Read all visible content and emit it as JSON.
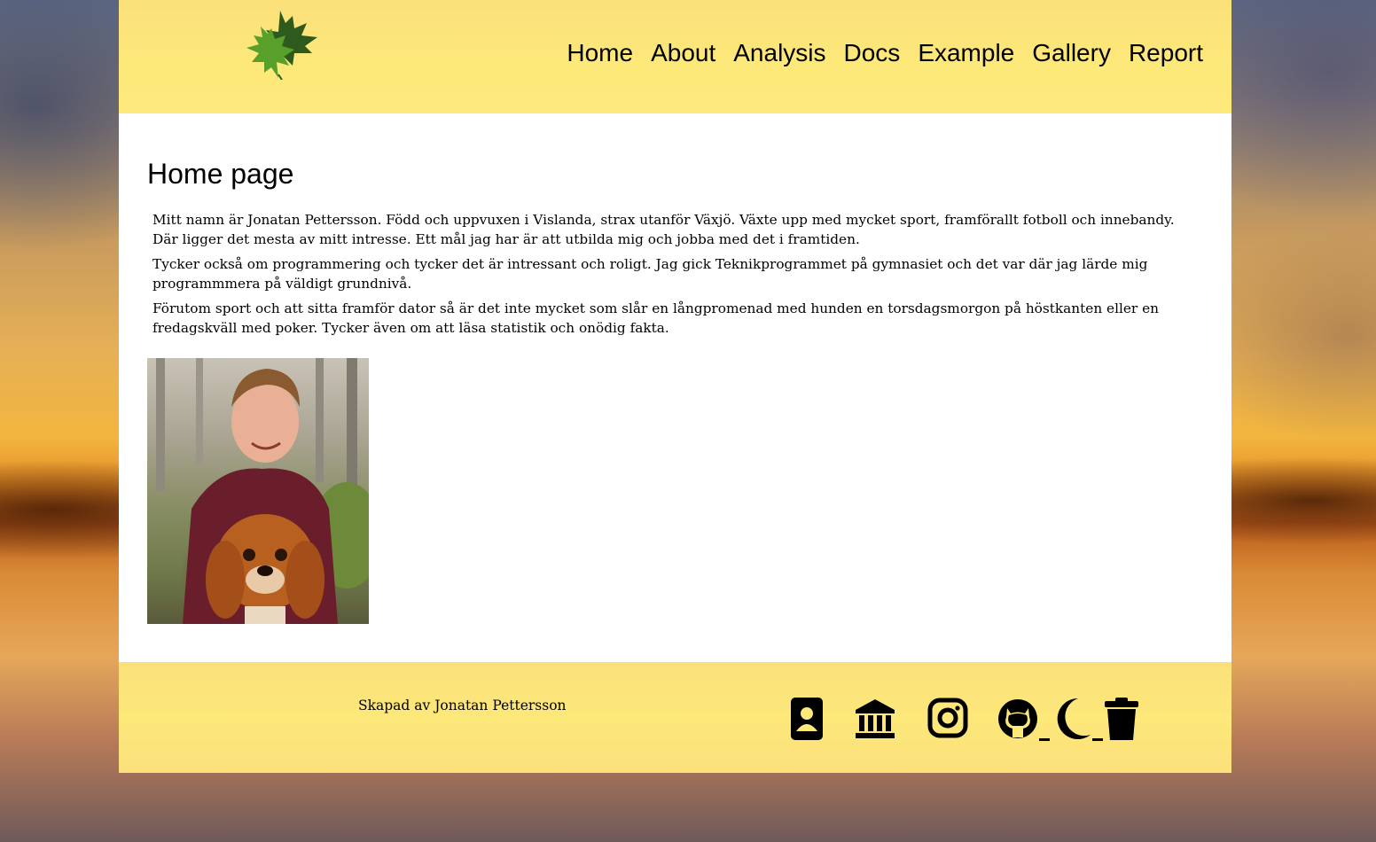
{
  "site": {
    "logo_icon": "maple-leaf-logo"
  },
  "nav": {
    "items": [
      {
        "label": "Home",
        "name": "nav-home"
      },
      {
        "label": "About",
        "name": "nav-about"
      },
      {
        "label": "Analysis",
        "name": "nav-analysis"
      },
      {
        "label": "Docs",
        "name": "nav-docs"
      },
      {
        "label": "Example",
        "name": "nav-example"
      },
      {
        "label": "Gallery",
        "name": "nav-gallery"
      },
      {
        "label": "Report",
        "name": "nav-report"
      }
    ]
  },
  "main": {
    "title": "Home page",
    "paragraphs": [
      "Mitt namn är Jonatan Pettersson. Född och uppvuxen i Vislanda, strax utanför Växjö. Växte upp med mycket sport, framförallt fotboll och innebandy. Där ligger det mesta av mitt intresse. Ett mål jag har är att utbilda mig och jobba med det i framtiden.",
      "Tycker också om programmering och tycker det är intressant och roligt. Jag gick Teknikprogrammet på gymnasiet och det var där jag lärde mig programmmera på väldigt grundnivå.",
      "Förutom sport och att sitta framför dator så är det inte mycket som slår en långpromenad med hunden en torsdagsmorgon på höstkanten eller en fredagskväll med poker. Tycker även om att läsa statistik och onödig fakta."
    ],
    "photo_icon": "profile-photo"
  },
  "footer": {
    "credit": "Skapad av Jonatan Pettersson",
    "icons": [
      "contact-card-icon",
      "bank-icon",
      "instagram-icon",
      "github-icon",
      "moon-icon",
      "trash-icon"
    ]
  },
  "colors": {
    "header_bg": "#fde87a",
    "text": "#000000",
    "content_bg": "#ffffff"
  }
}
